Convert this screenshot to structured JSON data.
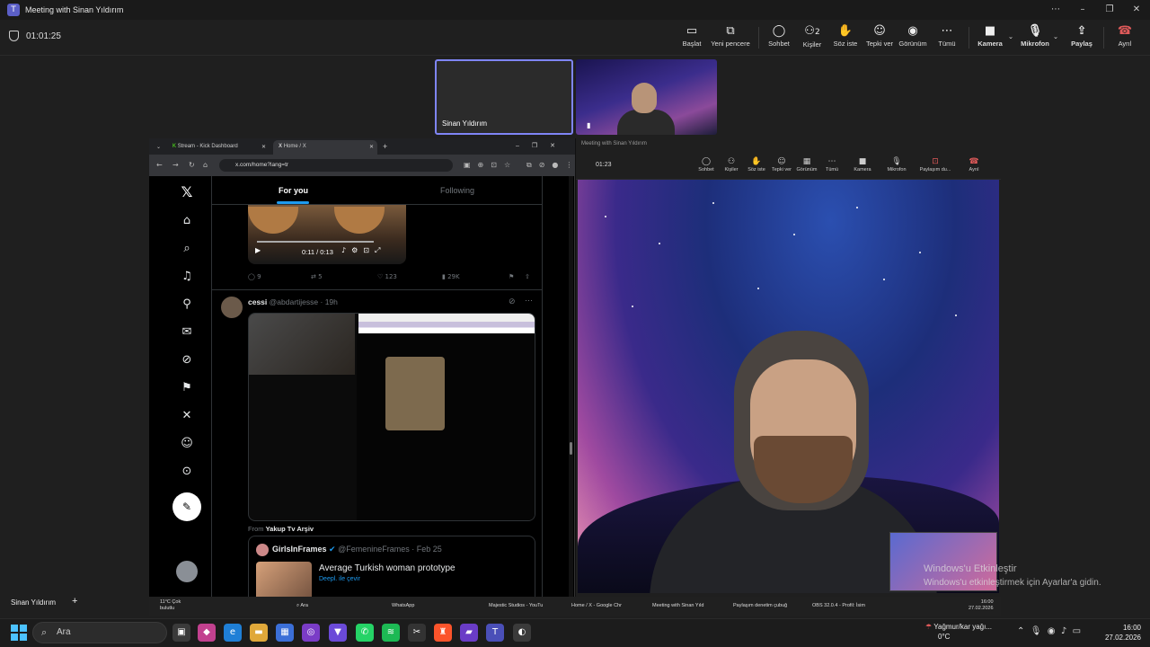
{
  "window": {
    "title": "Meeting with Sinan Yıldırım"
  },
  "toolbar": {
    "timer": "01:01:25",
    "buttons": [
      {
        "label": "Başlat",
        "icon": "monitor-icon"
      },
      {
        "label": "Yeni pencere",
        "icon": "new-window-icon"
      },
      {
        "label": "Sohbet",
        "icon": "chat-icon"
      },
      {
        "label": "Kişiler",
        "icon": "people-icon",
        "count": "2"
      },
      {
        "label": "Söz iste",
        "icon": "raise-hand-icon"
      },
      {
        "label": "Tepki ver",
        "icon": "emoji-icon"
      },
      {
        "label": "Görünüm",
        "icon": "view-icon"
      },
      {
        "label": "Tümü",
        "icon": "more-icon"
      },
      {
        "label": "Kamera",
        "icon": "camera-icon"
      },
      {
        "label": "Mikrofon",
        "icon": "mic-icon"
      },
      {
        "label": "Paylaş",
        "icon": "share-icon"
      },
      {
        "label": "Ayrıl",
        "icon": "hangup-icon"
      }
    ]
  },
  "participants": {
    "tile1_name": "Sinan Yıldırım"
  },
  "browser": {
    "tabs": [
      "Stream - Kick Dashboard",
      "Home / X"
    ],
    "url": "x.com/home?lang=tr"
  },
  "feed": {
    "tab_for_you": "For you",
    "tab_following": "Following",
    "video_time": "0:11 / 0:13",
    "actions": {
      "replies": "9",
      "reposts": "5",
      "likes": "123",
      "views": "29K"
    },
    "tweet2": {
      "name": "cessi",
      "handle": "@abdartijesse",
      "time": "· 19h"
    },
    "from_label": "From",
    "from_name": "Yakup Tv Arşiv",
    "quote": {
      "name": "GirlsInFrames",
      "handle": "@FemenineFrames",
      "date": "· Feb 25",
      "text": "Average Turkish woman prototype",
      "translate": "Deepl. ile çevir"
    }
  },
  "inner": {
    "title": "Meeting with Sinan Yıldırım",
    "time": "01:23",
    "buttons": [
      "Sohbet",
      "Kişiler",
      "Söz iste",
      "Tepki ver",
      "Görünüm",
      "Tümü",
      "Kamera",
      "Mikrofon",
      "Paylaşım du...",
      "Ayrıl"
    ]
  },
  "watermark": {
    "line1": "Windows'u Etkinleştir",
    "line2": "Windows'u etkinleştirmek için Ayarlar'a gidin."
  },
  "inner_taskbar": {
    "weather": "11°C Çok bulutlu",
    "search": "Ara",
    "items": [
      "WhatsApp",
      "Majestic Studios - YouTu",
      "Home / X - Google Chr",
      "Meeting with Sinan Yıld",
      "Paylaşım denetim çubuğ",
      "OBS 32.0.4 - Profil: İsim"
    ],
    "clock_time": "16:00",
    "clock_date": "27.02.2026"
  },
  "self": {
    "name": "Sinan Yıldırım"
  },
  "taskbar": {
    "search": "Ara",
    "weather_line1": "Yağmur/kar yağı...",
    "weather_line2": "0°C",
    "time": "16:00",
    "date": "27.02.2026"
  }
}
